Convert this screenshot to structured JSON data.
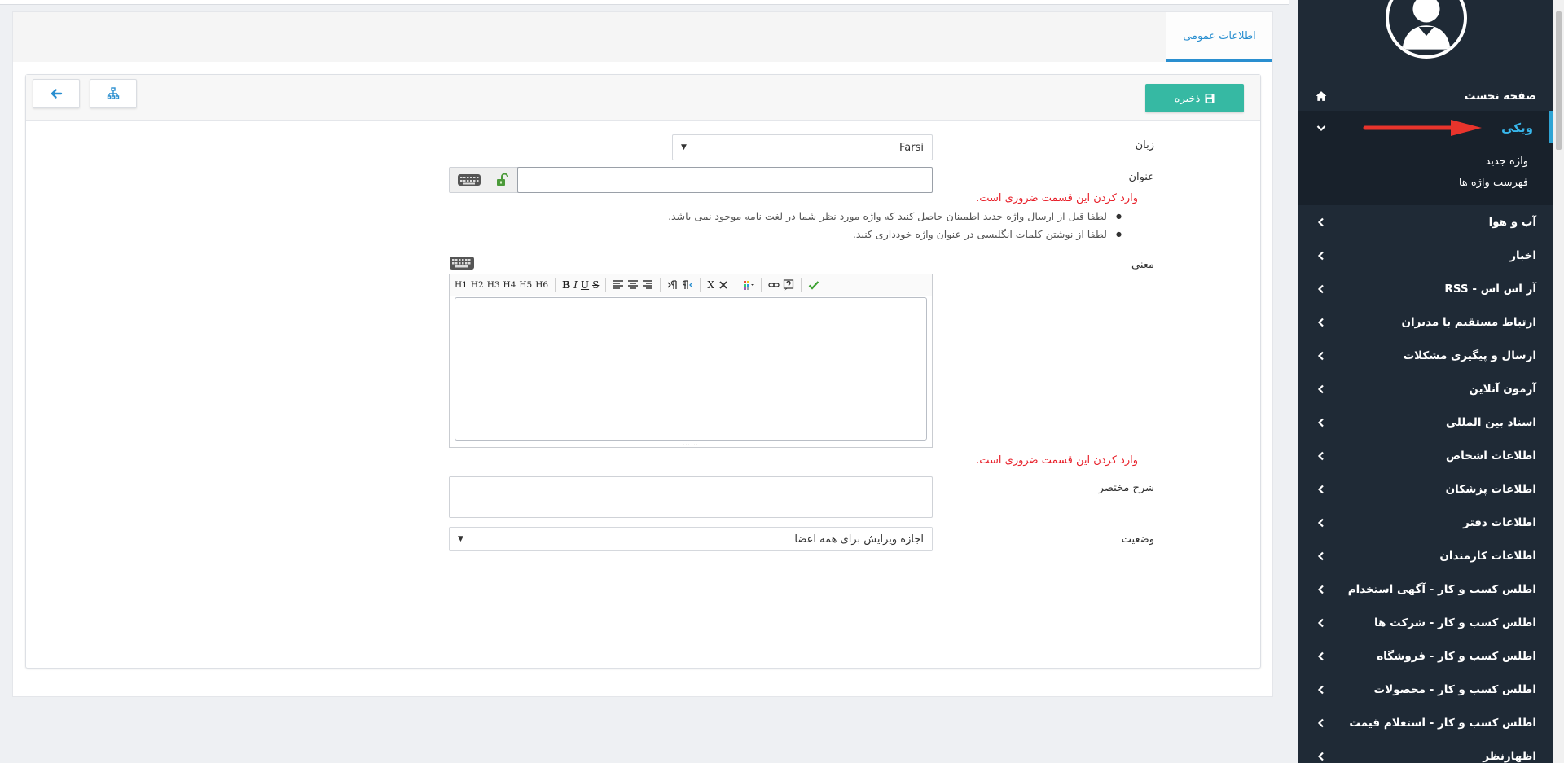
{
  "tabs": [
    {
      "label": "اطلاعات عمومی"
    }
  ],
  "toolbar": {
    "save_label": "ذخیره"
  },
  "form": {
    "language": {
      "label": "زبان",
      "value": "Farsi"
    },
    "title": {
      "label": "عنوان",
      "value": "",
      "error": "وارد کردن این قسمت ضروری است."
    },
    "hints": [
      "لطفا قبل از ارسال واژه جدید اطمینان حاصل کنید که واژه مورد نظر شما در لغت نامه موجود نمی باشد.",
      "لطفا از نوشتن کلمات انگلیسی در عنوان واژه خودداری کنید."
    ],
    "meaning": {
      "label": "معنی",
      "error": "وارد کردن این قسمت ضروری است."
    },
    "editor_toolbar": {
      "headings": [
        "H1",
        "H2",
        "H3",
        "H4",
        "H5",
        "H6"
      ],
      "bold": "B",
      "italic": "I",
      "underline": "U",
      "strike": "S",
      "clear": "X"
    },
    "summary": {
      "label": "شرح مختصر",
      "value": ""
    },
    "status": {
      "label": "وضعیت",
      "value": "اجازه ویرایش برای همه اعضا"
    }
  },
  "sidebar": {
    "home": "صفحه نخست",
    "active": "ویکی",
    "sub_items": [
      "واژه جدید",
      "فهرست واژه ها"
    ],
    "items": [
      "آب و هوا",
      "اخبار",
      "آر اس اس - RSS",
      "ارتباط مستقیم با مدیران",
      "ارسال و پیگیری مشکلات",
      "آزمون آنلاین",
      "اسناد بین المللی",
      "اطلاعات اشخاص",
      "اطلاعات پزشکان",
      "اطلاعات دفتر",
      "اطلاعات کارمندان",
      "اطلس کسب و کار - آگهی استخدام",
      "اطلس کسب و کار - شرکت ها",
      "اطلس کسب و کار - فروشگاه",
      "اطلس کسب و کار - محصولات",
      "اطلس کسب و کار - استعلام قیمت",
      "اظهارنظر"
    ]
  },
  "colors": {
    "accent": "#2a8fd0",
    "save": "#36b9a3",
    "error": "#e8202a",
    "sidebar": "#1f2a36"
  }
}
